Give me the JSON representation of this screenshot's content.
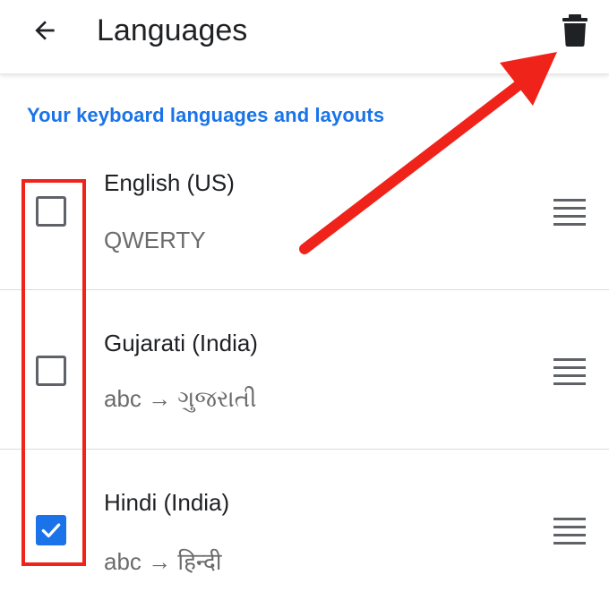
{
  "appbar": {
    "title": "Languages",
    "back_icon": "arrow-back-icon",
    "delete_icon": "trash-icon"
  },
  "section": {
    "title": "Your keyboard languages and layouts"
  },
  "languages": [
    {
      "name": "English (US)",
      "layout": "QWERTY",
      "checked": false
    },
    {
      "name": "Gujarati (India)",
      "layout": "abc → ગુજરાતી",
      "checked": false
    },
    {
      "name": "Hindi (India)",
      "layout": "abc → हिन्दी",
      "checked": true
    }
  ],
  "colors": {
    "accent": "#1a73e8",
    "annotation": "#f0231b",
    "text_primary": "#202124",
    "text_secondary": "#6b6b6b",
    "icon": "#202124"
  }
}
